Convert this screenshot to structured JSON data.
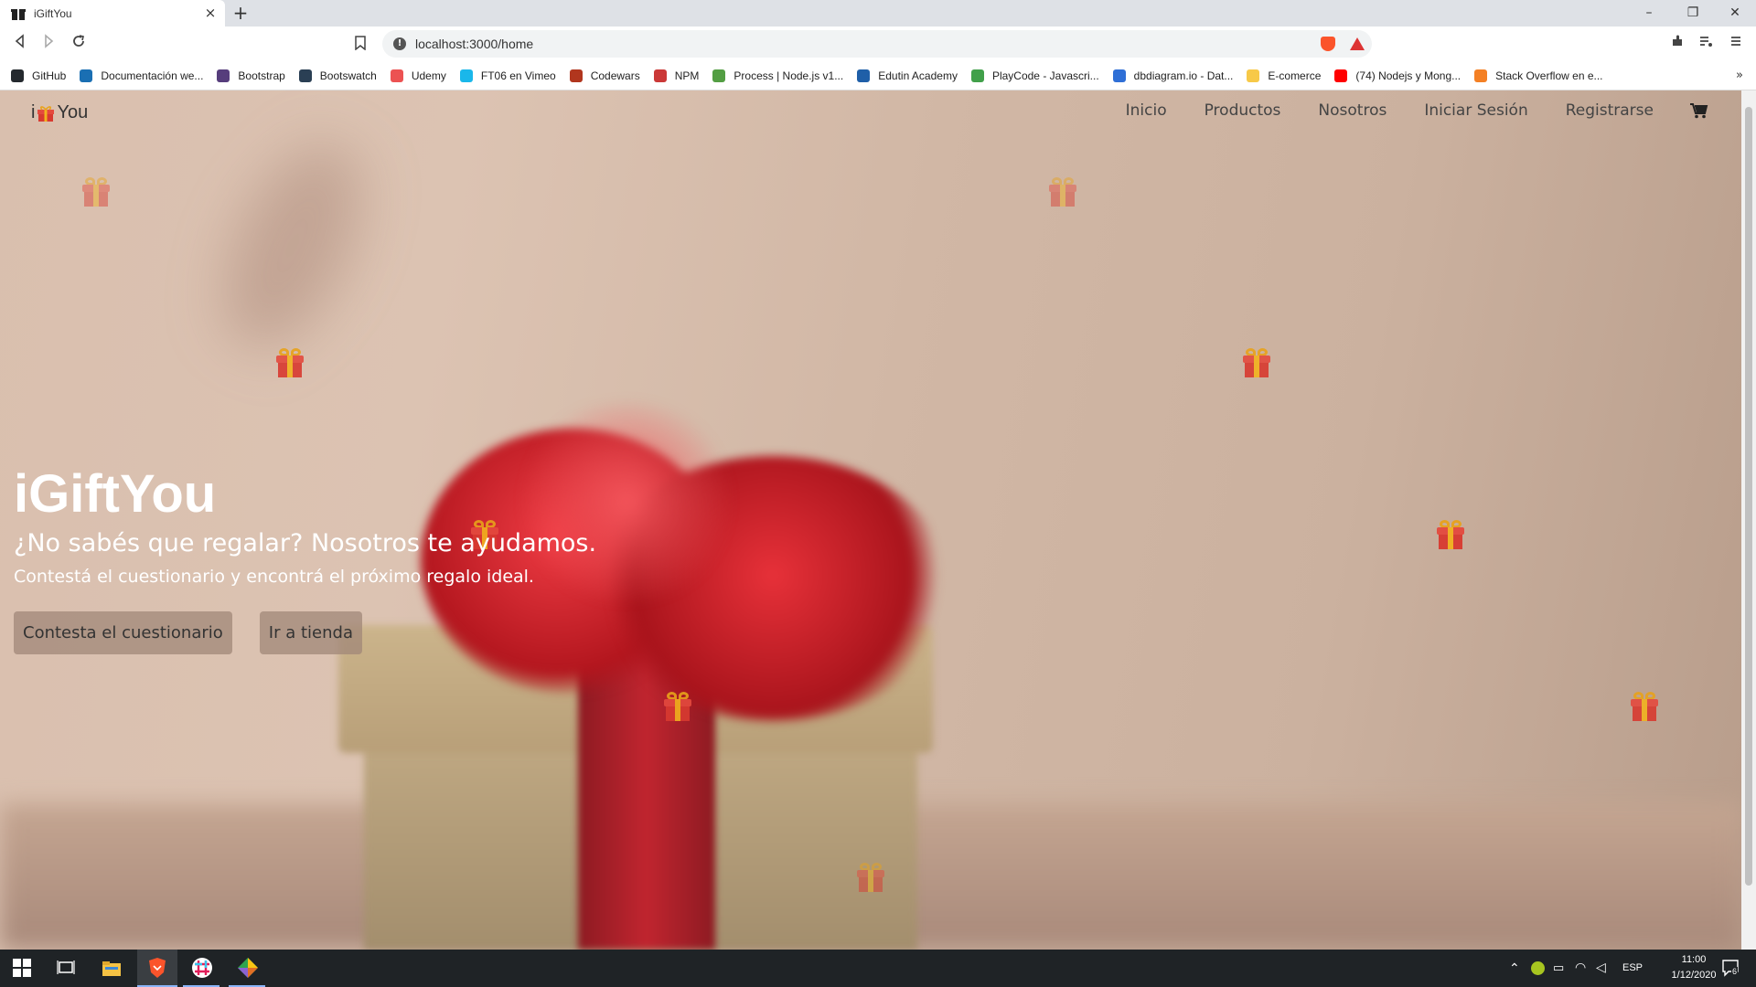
{
  "browser": {
    "tab_title": "iGiftYou",
    "close_glyph": "×",
    "new_tab_glyph": "+",
    "url": "localhost:3000/home",
    "window": {
      "minimize": "–",
      "restore": "❐",
      "close": "✕"
    },
    "bookmarks": [
      {
        "label": "GitHub",
        "color": "#24292e"
      },
      {
        "label": "Documentación we...",
        "color": "#1a6fb3"
      },
      {
        "label": "Bootstrap",
        "color": "#563d7c"
      },
      {
        "label": "Bootswatch",
        "color": "#2a3f54"
      },
      {
        "label": "Udemy",
        "color": "#ec5252"
      },
      {
        "label": "FT06 en Vimeo",
        "color": "#1ab7ea"
      },
      {
        "label": "Codewars",
        "color": "#b1361e"
      },
      {
        "label": "NPM",
        "color": "#cb3837"
      },
      {
        "label": "Process | Node.js v1...",
        "color": "#539e43"
      },
      {
        "label": "Edutin Academy",
        "color": "#1f5fa8"
      },
      {
        "label": "PlayCode - Javascri...",
        "color": "#41a04a"
      },
      {
        "label": "dbdiagram.io - Dat...",
        "color": "#2f6fd6"
      },
      {
        "label": "E-comerce",
        "color": "#f7c948"
      },
      {
        "label": "(74) Nodejs y Mong...",
        "color": "#ff0000"
      },
      {
        "label": "Stack Overflow en e...",
        "color": "#f48024"
      }
    ],
    "bookmarks_more": "»"
  },
  "site": {
    "brand_prefix": "i",
    "brand_suffix": "You",
    "nav": [
      "Inicio",
      "Productos",
      "Nosotros",
      "Iniciar Sesión",
      "Registrarse"
    ],
    "hero": {
      "title": "iGiftYou",
      "subtitle": "¿No sabés que regalar? Nosotros te ayudamos.",
      "text": "Contestá el cuestionario y encontrá el próximo regalo ideal.",
      "button_quiz": "Contesta el cuestionario",
      "button_store": "Ir a tienda"
    }
  },
  "taskbar": {
    "lang": "ESP",
    "time": "11:00",
    "date": "1/12/2020",
    "notifications": "6"
  }
}
